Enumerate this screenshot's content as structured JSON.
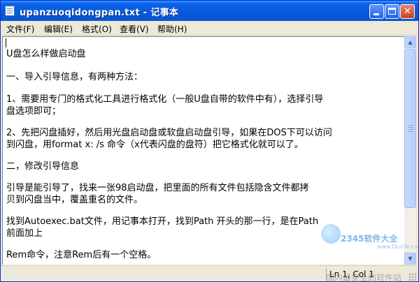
{
  "window": {
    "title": "upanzuoqidongpan.txt - 记事本",
    "controls": {
      "minimize": "",
      "maximize": "",
      "close": "✕"
    }
  },
  "menu": {
    "items": [
      {
        "label": "文件(F)"
      },
      {
        "label": "编辑(E)"
      },
      {
        "label": "格式(O)"
      },
      {
        "label": "查看(V)"
      },
      {
        "label": "帮助(H)"
      }
    ]
  },
  "document": {
    "lines": [
      "U盘怎么样做启动盘",
      "一、导入引导信息，有两种方法：",
      "1、需要用专门的格式化工具进行格式化（一般U盘自带的软件中有），选择引导",
      "盘选项即可；",
      "2、先把闪盘插好，然后用光盘启动盘或软盘启动盘引导，如果在DOS下可以访问",
      "到闪盘，用format x: /s 命令（x代表闪盘的盘符）把它格式化就可以了。",
      "二，修改引导信息",
      "      引导是能引导了，找来一张98启动盘，把里面的所有文件包括隐含文件都拷",
      "贝到闪盘当中，覆盖重名的文件。",
      "      找到Autoexec.bat文件，用记事本打开，找到Path 开头的那一行，是在Path",
      "前面加上",
      "Rem命令，注意Rem后有一个空格。"
    ]
  },
  "scrollbar": {
    "up_arrow": "▲",
    "down_arrow": "▼"
  },
  "status": {
    "position": "Ln 1, Col 1"
  },
  "watermark": {
    "brand": "2345软件大全",
    "url": "www.DuoTe.com",
    "slogan": "国内最安全的软件站"
  },
  "colors": {
    "titlebar": "#0758dc",
    "close_button": "#c7431c",
    "menubar": "#ece9d8",
    "editor_bg": "#ffffff"
  }
}
